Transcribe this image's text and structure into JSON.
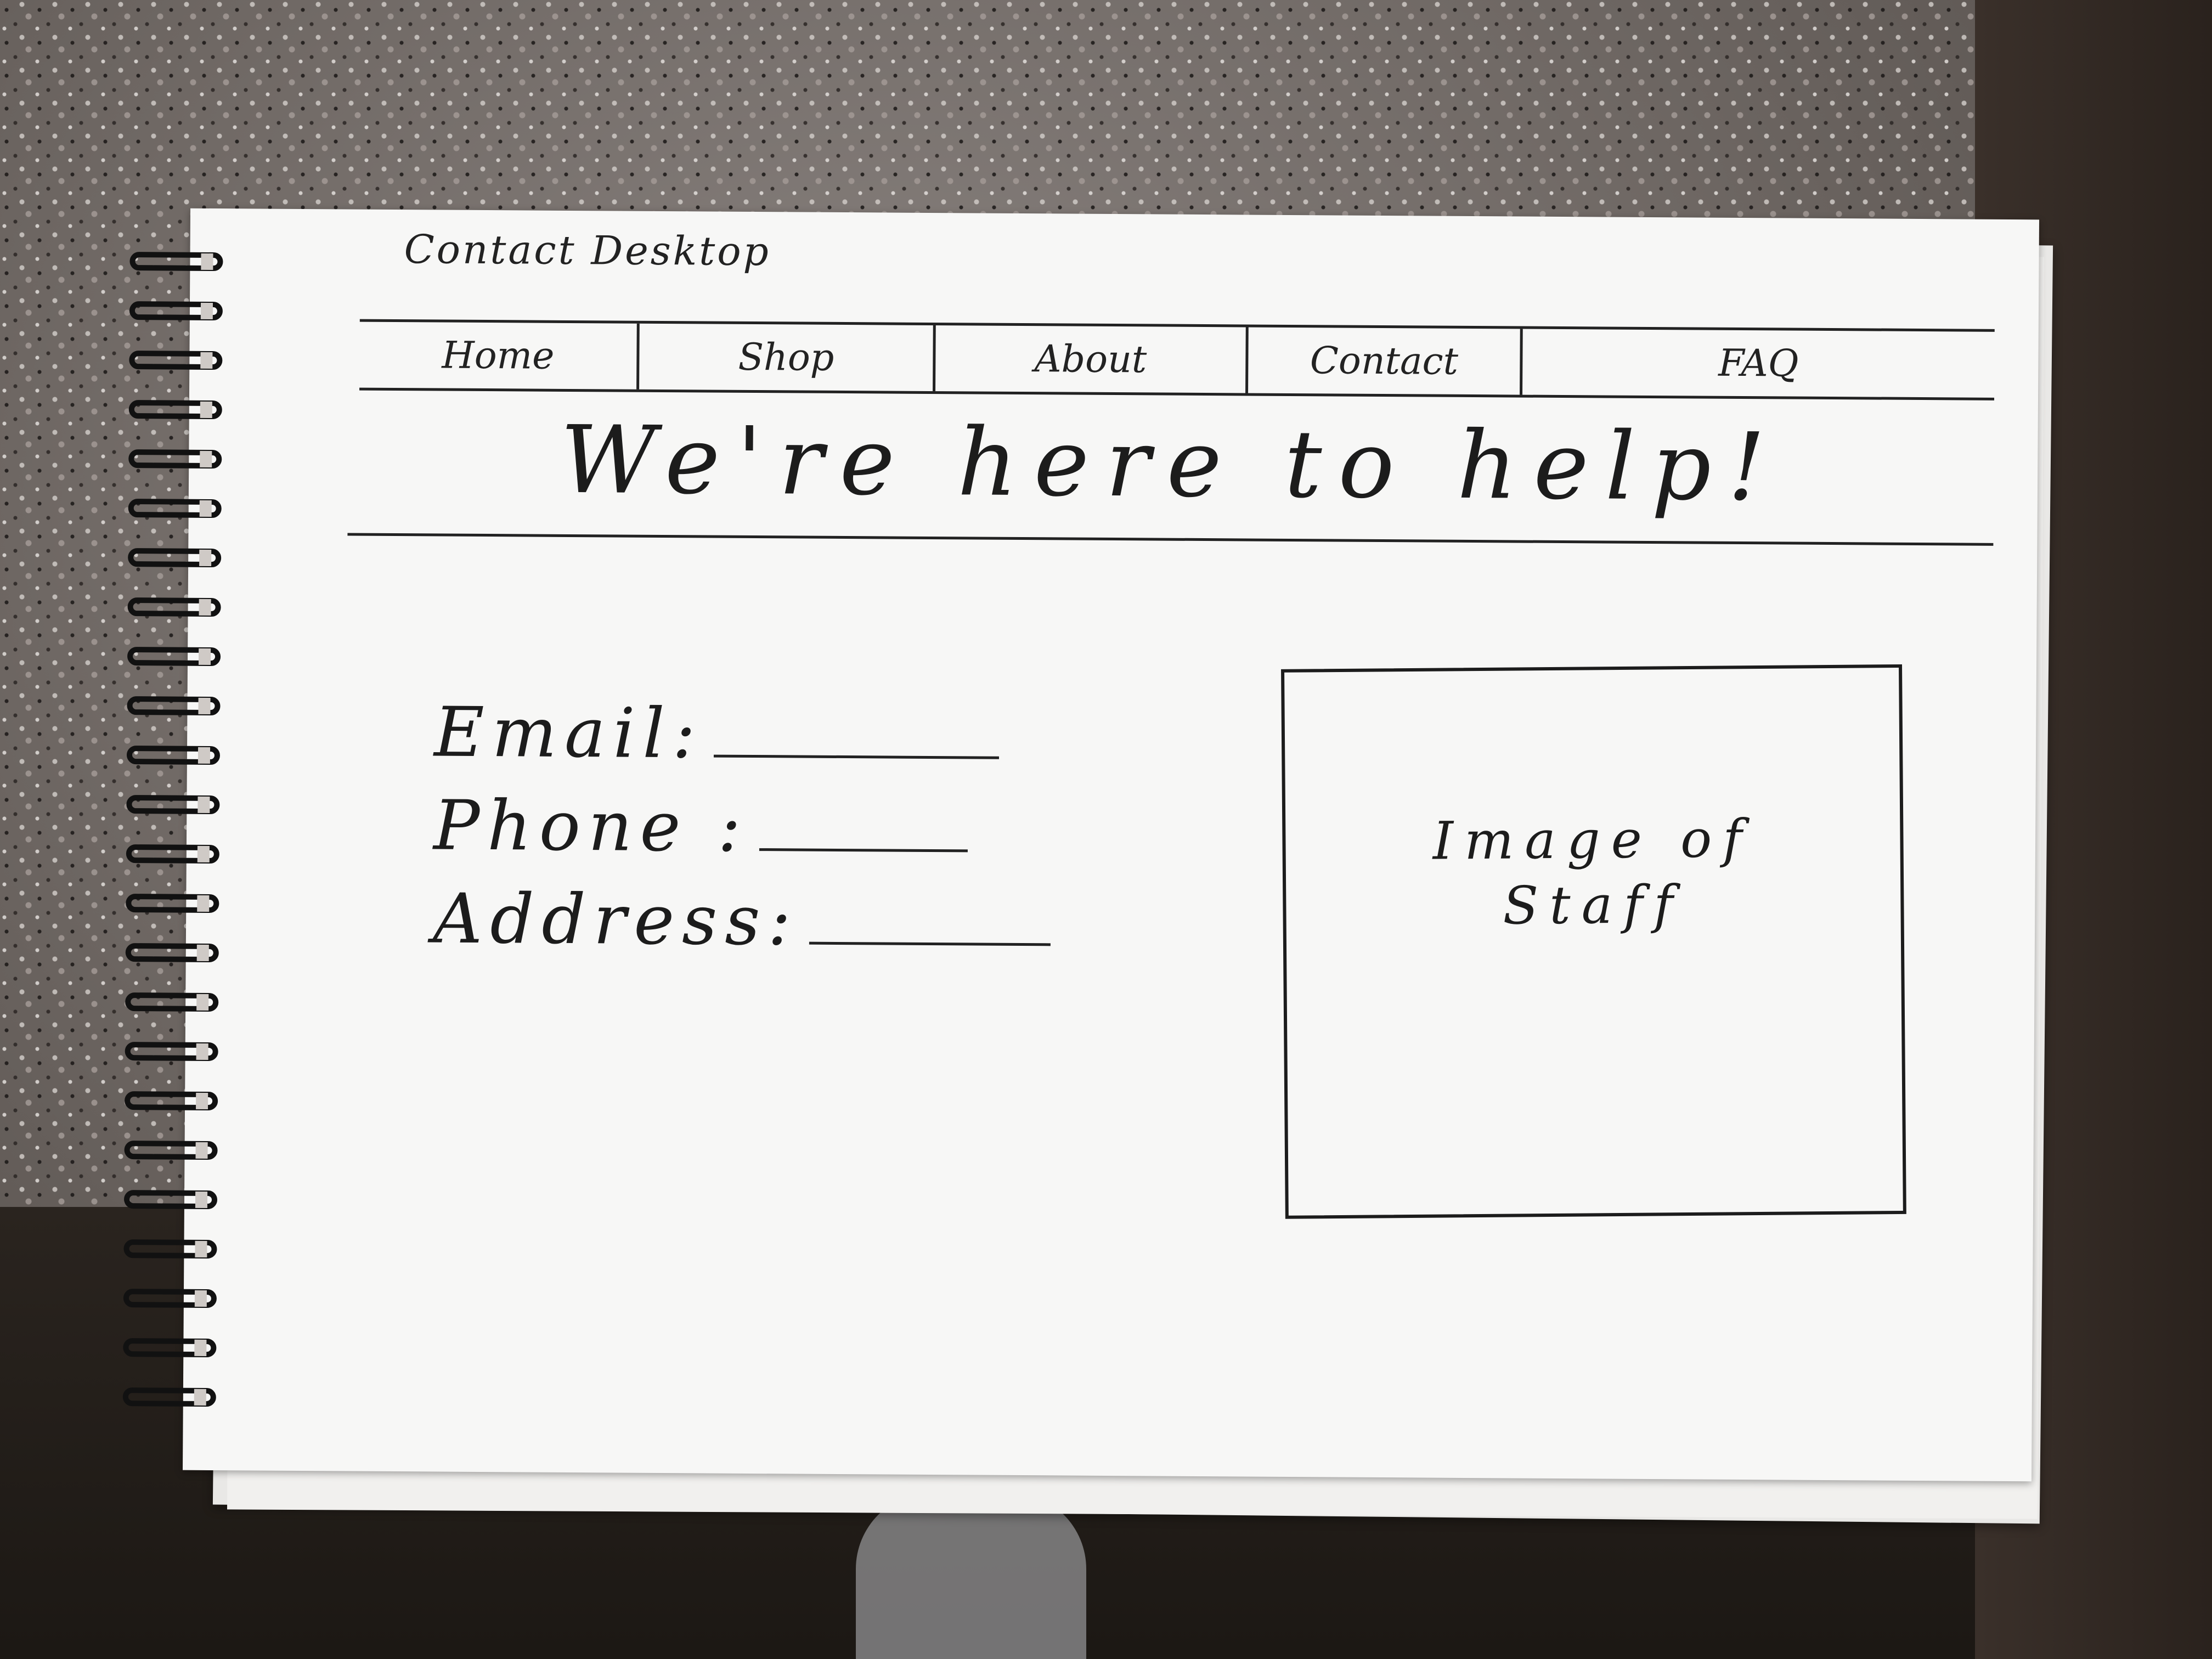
{
  "page": {
    "title": "Contact Desktop"
  },
  "nav": {
    "items": [
      {
        "label": "Home"
      },
      {
        "label": "Shop"
      },
      {
        "label": "About"
      },
      {
        "label": "Contact"
      },
      {
        "label": "FAQ"
      }
    ]
  },
  "hero": {
    "heading": "We're here to help!"
  },
  "contact_form": {
    "email_label": "Email:",
    "phone_label": "Phone :",
    "address_label": "Address:"
  },
  "staff_image": {
    "placeholder_text": "Image of Staff"
  }
}
